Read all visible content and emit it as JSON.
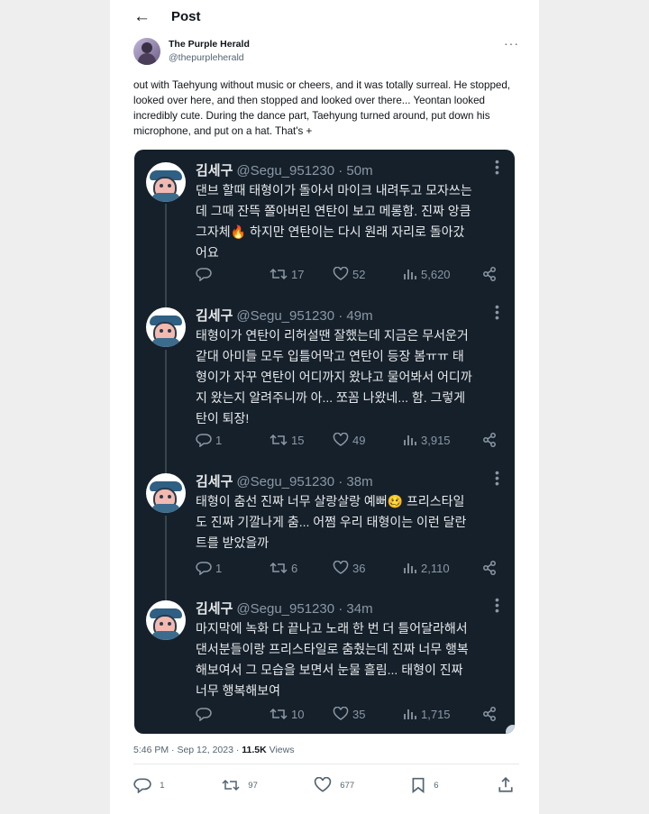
{
  "header": {
    "back_icon": "arrow-left-icon",
    "title": "Post"
  },
  "author": {
    "name": "The Purple Herald",
    "handle": "@thepurpleherald"
  },
  "post_text": "out with Taehyung without music or cheers, and it was totally surreal. He stopped, looked over here, and then stopped and looked over there... Yeontan looked incredibly cute. During the dance part, Taehyung turned around, put down his microphone, and put on a hat. That's +",
  "embedded_tweets": [
    {
      "name": "김세구",
      "handle": "@Segu_951230",
      "time": "50m",
      "text": "댄브 할때 태형이가 돌아서 마이크 내려두고 모자쓰는\n데 그때 잔뜩 쫄아버린 연탄이 보고 메롱함. 진짜 앙큼\n그자체🔥 하지만 연탄이는 다시 원래 자리로 돌아갔\n어요",
      "replies": "",
      "retweets": "17",
      "likes": "52",
      "views": "5,620"
    },
    {
      "name": "김세구",
      "handle": "@Segu_951230",
      "time": "49m",
      "text": "태형이가 연탄이 리허설땐 잘했는데 지금은 무서운거\n같대 아미들 모두 입틀어막고 연탄이 등장 봄ㅠㅠ 태\n형이가 자꾸 연탄이 어디까지 왔냐고 물어봐서 어디까\n지 왔는지 알려주니까 아... 쪼꼼 나왔네... 함. 그렇게\n탄이 퇴장!",
      "replies": "1",
      "retweets": "15",
      "likes": "49",
      "views": "3,915"
    },
    {
      "name": "김세구",
      "handle": "@Segu_951230",
      "time": "38m",
      "text": "태형이 춤선 진짜 너무 살랑살랑 예뻐🥴 프리스타일\n도 진짜 기깔나게 춤... 어쩜 우리 태형이는 이런 달란\n트를 받았을까",
      "replies": "1",
      "retweets": "6",
      "likes": "36",
      "views": "2,110"
    },
    {
      "name": "김세구",
      "handle": "@Segu_951230",
      "time": "34m",
      "text": "마지막에 녹화 다 끝나고 노래 한 번 더 틀어달라해서\n댄서분들이랑 프리스타일로 춤췄는데 진짜 너무 행복\n해보여서 그 모습을 보면서 눈물 흘림... 태형이 진짜\n너무 행복해보여",
      "replies": "",
      "retweets": "10",
      "likes": "35",
      "views": "1,715"
    }
  ],
  "footer": {
    "time": "5:46 PM",
    "date": "Sep 12, 2023",
    "views_count": "11.5K",
    "views_label": "Views"
  },
  "actions": {
    "replies": "1",
    "reposts": "97",
    "likes": "677",
    "bookmarks": "6"
  },
  "colors": {
    "card_bg": "#15202b",
    "text_dark": "#e7e9ea",
    "muted": "#8b98a5"
  }
}
